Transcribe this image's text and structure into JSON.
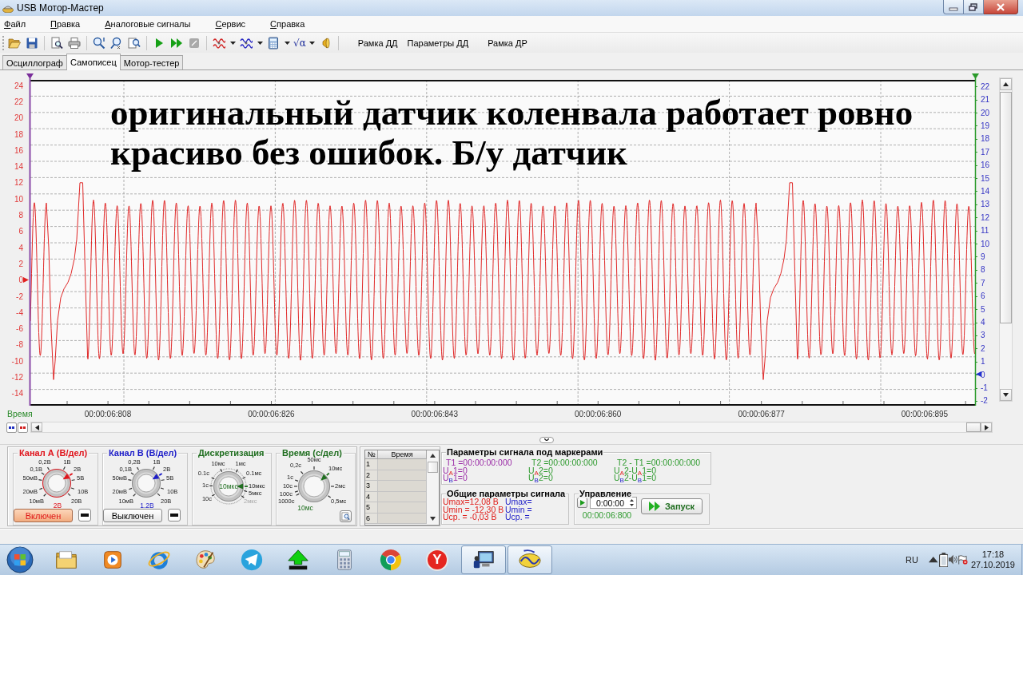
{
  "window": {
    "title": "USB Мотор-Мастер"
  },
  "menu": [
    "Файл",
    "Правка",
    "Аналоговые сигналы",
    "Сервис",
    "Справка"
  ],
  "toolbar": {
    "run_buttons": [
      {
        "kind": "play",
        "disabled": false
      },
      {
        "kind": "fast-forward",
        "disabled": false
      },
      {
        "kind": "stop",
        "disabled": true
      }
    ],
    "formula_button": "√α",
    "text_buttons": [
      "Рамка ДД",
      "Параметры ДД",
      "Рамка ДР"
    ]
  },
  "tabs": [
    {
      "label": "Осциллограф",
      "selected": false
    },
    {
      "label": "Самописец",
      "selected": true
    },
    {
      "label": "Мотор-тестер",
      "selected": false
    }
  ],
  "chart": {
    "caption_lines": [
      "оригинальный датчик коленвала работает ровно",
      "красиво без ошибок. Б/у датчик"
    ],
    "left_axis": [
      "24",
      "22",
      "20",
      "18",
      "16",
      "14",
      "12",
      "10",
      "8",
      "6",
      "4",
      "2",
      "0",
      "-2",
      "-4",
      "-6",
      "-8",
      "-10",
      "-12",
      "-14"
    ],
    "right_axis": [
      "22",
      "21",
      "20",
      "19",
      "18",
      "17",
      "16",
      "15",
      "14",
      "13",
      "12",
      "11",
      "10",
      "9",
      "8",
      "7",
      "6",
      "5",
      "4",
      "3",
      "2",
      "1",
      "0",
      "-1",
      "-2"
    ],
    "x_title": "Время",
    "time_labels": [
      "00:00:06:808",
      "00:00:06:826",
      "00:00:06:843",
      "00:00:06:860",
      "00:00:06:877",
      "00:00:06:895"
    ]
  },
  "dials": [
    {
      "kind": "channel",
      "title": "Канал А (В/дел)",
      "color": "#e0141c",
      "scale": [
        {
          "text": "0,2В",
          "selected": false
        },
        {
          "text": "1В",
          "selected": false
        },
        {
          "text": "0,1В",
          "selected": false
        },
        {
          "text": "2В",
          "selected": true
        },
        {
          "text": "50мВ",
          "selected": false
        },
        {
          "text": "5В",
          "selected": false
        },
        {
          "text": "20мВ",
          "selected": false
        },
        {
          "text": "10В",
          "selected": false
        },
        {
          "text": "10мВ",
          "selected": false
        },
        {
          "text": "20В",
          "selected": false
        }
      ],
      "value": "2В",
      "switch": {
        "label": "Включен",
        "on": true
      }
    },
    {
      "kind": "channel",
      "title": "Канал В (В/дел)",
      "color": "#1c1cc8",
      "scale": [
        {
          "text": "0,2В",
          "selected": false
        },
        {
          "text": "1В",
          "selected": false
        },
        {
          "text": "0,1В",
          "selected": false
        },
        {
          "text": "2В",
          "selected": true
        },
        {
          "text": "50мВ",
          "selected": false
        },
        {
          "text": "5В",
          "selected": false
        },
        {
          "text": "20мВ",
          "selected": false
        },
        {
          "text": "10В",
          "selected": false
        },
        {
          "text": "10мВ",
          "selected": false
        },
        {
          "text": "20В",
          "selected": false
        }
      ],
      "value": "1.2В",
      "switch": {
        "label": "Выключен",
        "on": false
      }
    },
    {
      "kind": "sampling",
      "title": "Дискретизация",
      "color": "#1f6e1f",
      "scale": [
        {
          "text": "10мс",
          "selected": false,
          "disabled": false
        },
        {
          "text": "1мс",
          "selected": false,
          "disabled": false
        },
        {
          "text": "0.1с",
          "selected": false,
          "disabled": false
        },
        {
          "text": "0.1мс",
          "selected": false,
          "disabled": false
        },
        {
          "text": "1с",
          "selected": false,
          "disabled": false
        },
        {
          "text": "10мкс",
          "selected": true,
          "disabled": false
        },
        {
          "text": "5мкс",
          "selected": false,
          "disabled": false
        },
        {
          "text": "10с",
          "selected": false,
          "disabled": false
        },
        {
          "text": "2мкс",
          "selected": false,
          "disabled": true
        }
      ],
      "value": "10мкс"
    },
    {
      "kind": "time",
      "title": "Время (с/дел)",
      "color": "#1f6e1f",
      "scale": [
        {
          "text": "50мс",
          "selected": false
        },
        {
          "text": "0,2с",
          "selected": false
        },
        {
          "text": "10мс",
          "selected": true
        },
        {
          "text": "1с",
          "selected": false
        },
        {
          "text": "10с",
          "selected": false
        },
        {
          "text": "2мс",
          "selected": false
        },
        {
          "text": "100с",
          "selected": false
        },
        {
          "text": "1000с",
          "selected": false
        },
        {
          "text": "0,5мс",
          "selected": false
        }
      ],
      "value": "10мс"
    }
  ],
  "marker_table": {
    "columns": [
      "№",
      "Время"
    ],
    "rows": [
      "1",
      "2",
      "3",
      "4",
      "5",
      "6"
    ]
  },
  "marker_params": {
    "title": "Параметры сигнала под маркерами",
    "columns": [
      {
        "color": "#9a2aa6",
        "time": "T1 =00:00:00:000",
        "lines": [
          "U$_{A}$1=0",
          "U$_{B}$1=0"
        ]
      },
      {
        "color": "#2e9a2e",
        "time": "T2 =00:00:00:000",
        "lines": [
          "U$_{A}$2=0",
          "U$_{B}$2=0"
        ]
      },
      {
        "color": "#2e9a2e",
        "time": "T2 - T1 =00:00:00:000",
        "lines": [
          "U$_{A}$2-U$_{A}$1=0",
          "U$_{B}$2-U$_{B}$1=0"
        ]
      }
    ]
  },
  "signal_params": {
    "title": "Общие параметры сигнала",
    "columns": [
      {
        "color": "#e0201c",
        "lines": [
          "Umax=12,08 В",
          "Umin = -12,30 В",
          "Uср. = -0,03 В"
        ]
      },
      {
        "color": "#2020c8",
        "lines": [
          "Umax=",
          "Umin =",
          "Uср. ="
        ]
      }
    ]
  },
  "control": {
    "title": "Управление",
    "time_field": {
      "value": "0:00:00"
    },
    "elapsed": "00:00:06:800",
    "start_button": "Запуск"
  },
  "taskbar": {
    "apps": [
      {
        "kind": "folder",
        "active": false
      },
      {
        "kind": "media",
        "active": false
      },
      {
        "kind": "globe",
        "active": false
      },
      {
        "kind": "palette",
        "active": false
      },
      {
        "kind": "telegram",
        "active": false
      },
      {
        "kind": "arrow",
        "active": false
      },
      {
        "kind": "calculator",
        "active": false
      },
      {
        "kind": "chrome",
        "active": false
      },
      {
        "kind": "letter",
        "active": false,
        "glyph": "Y"
      },
      {
        "kind": "monitor",
        "active": true
      },
      {
        "kind": "oscope",
        "active": true
      }
    ],
    "language": "RU",
    "time": "17:18",
    "date": "27.10.2019"
  }
}
